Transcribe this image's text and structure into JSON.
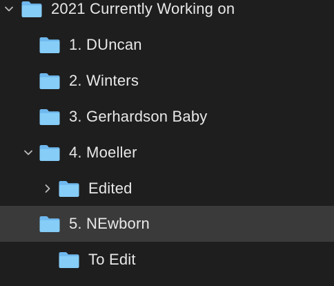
{
  "tree": {
    "items": [
      {
        "label": "2021 Currently Working on",
        "icon": "folder-icon",
        "disclosure": "expanded",
        "selected": false
      },
      {
        "label": "1. DUncan",
        "icon": "folder-icon",
        "disclosure": "none",
        "selected": false
      },
      {
        "label": "2. Winters",
        "icon": "folder-icon",
        "disclosure": "none",
        "selected": false
      },
      {
        "label": "3. Gerhardson Baby",
        "icon": "folder-icon",
        "disclosure": "none",
        "selected": false
      },
      {
        "label": "4. Moeller",
        "icon": "folder-icon",
        "disclosure": "expanded",
        "selected": false
      },
      {
        "label": "Edited",
        "icon": "folder-icon",
        "disclosure": "collapsed",
        "selected": false
      },
      {
        "label": "5. NEwborn",
        "icon": "folder-icon",
        "disclosure": "none",
        "selected": true
      },
      {
        "label": "To Edit",
        "icon": "folder-icon",
        "disclosure": "none",
        "selected": false
      }
    ]
  },
  "colors": {
    "background": "#1e1e1e",
    "selected_row": "#3a3a3a",
    "folder": "#7cc4f5",
    "text": "#e8e8e8",
    "chevron": "#bdbdbd"
  }
}
